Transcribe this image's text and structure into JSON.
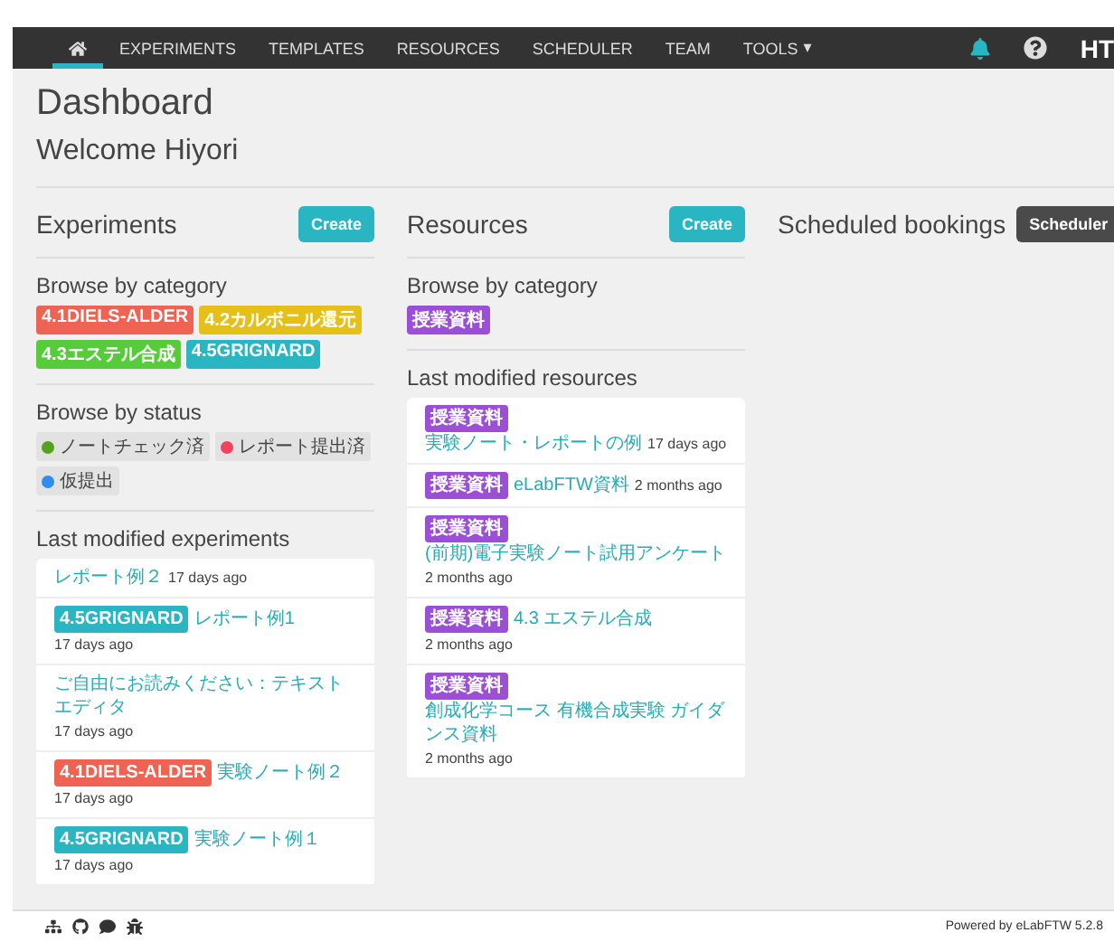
{
  "nav": {
    "items": [
      {
        "kind": "home",
        "selected": true
      },
      {
        "kind": "link",
        "label": "EXPERIMENTS",
        "selected": false
      },
      {
        "kind": "link",
        "label": "TEMPLATES",
        "selected": false
      },
      {
        "kind": "link",
        "label": "RESOURCES",
        "selected": false
      },
      {
        "kind": "link",
        "label": "SCHEDULER",
        "selected": false
      },
      {
        "kind": "link",
        "label": "TEAM",
        "selected": false
      },
      {
        "kind": "dropdown",
        "label": "TOOLS",
        "caret": "▾",
        "selected": false
      }
    ],
    "user": "HT"
  },
  "title": "Dashboard",
  "welcome": "Welcome Hiyori",
  "experiments": {
    "heading": "Experiments",
    "button": "Create",
    "category_heading": "Browse by category",
    "categories": [
      {
        "label": "4.1DIELS-ALDER",
        "color": "#ee6352"
      },
      {
        "label": "4.2カルボニル還元",
        "color": "#e6c01a"
      },
      {
        "label": "4.3エステル合成",
        "color": "#57cc3a"
      },
      {
        "label": "4.5GRIGNARD",
        "color": "#29b6c2"
      }
    ],
    "status_heading": "Browse by status",
    "statuses": [
      {
        "label": "ノートチェック済",
        "color": "#54a31d"
      },
      {
        "label": "レポート提出済",
        "color": "#f0435f"
      },
      {
        "label": "仮提出",
        "color": "#2b8ef0"
      }
    ],
    "recent_heading": "Last modified experiments",
    "recent": [
      {
        "title": "レポート例２",
        "time": "17 days ago"
      },
      {
        "tag": {
          "label": "4.5GRIGNARD",
          "color": "#29b6c2"
        },
        "title": "レポート例1",
        "time": "17 days ago"
      },
      {
        "title": "ご自由にお読みください：テキストエディタ",
        "time": "17 days ago"
      },
      {
        "tag": {
          "label": "4.1DIELS-ALDER",
          "color": "#ee6352"
        },
        "title": "実験ノート例２",
        "time": "17 days ago"
      },
      {
        "tag": {
          "label": "4.5GRIGNARD",
          "color": "#29b6c2"
        },
        "title": "実験ノート例１",
        "time": "17 days ago"
      }
    ]
  },
  "resources": {
    "heading": "Resources",
    "button": "Create",
    "category_heading": "Browse by category",
    "categories": [
      {
        "label": "授業資料",
        "color": "#9b4fd6"
      }
    ],
    "recent_heading": "Last modified resources",
    "recent": [
      {
        "tag": {
          "label": "授業資料",
          "color": "#9b4fd6"
        },
        "title": "実験ノート・レポートの例",
        "time": "17 days ago"
      },
      {
        "tag": {
          "label": "授業資料",
          "color": "#9b4fd6"
        },
        "title": "eLabFTW資料",
        "time": "2 months ago"
      },
      {
        "tag": {
          "label": "授業資料",
          "color": "#9b4fd6"
        },
        "title": "(前期)電子実験ノート試用アンケート",
        "time": "2 months ago"
      },
      {
        "tag": {
          "label": "授業資料",
          "color": "#9b4fd6"
        },
        "title": "4.3 エステル合成",
        "time": "2 months ago"
      },
      {
        "tag": {
          "label": "授業資料",
          "color": "#9b4fd6"
        },
        "title": "創成化学コース 有機合成実験 ガイダンス資料",
        "time": "2 months ago"
      }
    ]
  },
  "bookings": {
    "heading": "Scheduled bookings",
    "button": "Scheduler"
  },
  "footer": {
    "powered": "Powered by eLabFTW 5.2.8"
  }
}
